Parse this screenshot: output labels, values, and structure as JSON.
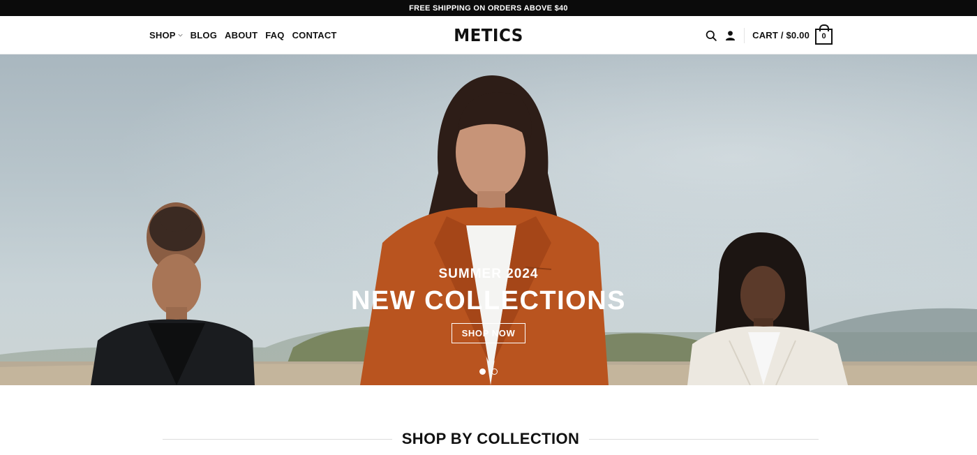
{
  "promo": {
    "text": "FREE SHIPPING ON ORDERS ABOVE $40"
  },
  "nav": {
    "items": [
      {
        "label": "SHOP",
        "has_dropdown": true
      },
      {
        "label": "BLOG"
      },
      {
        "label": "ABOUT"
      },
      {
        "label": "FAQ"
      },
      {
        "label": "CONTACT"
      }
    ]
  },
  "brand": {
    "logo": "METICS"
  },
  "header_actions": {
    "search_icon": "search-icon",
    "account_icon": "user-icon",
    "cart_label": "CART / $0.00",
    "cart_count": "0"
  },
  "hero": {
    "subtitle": "SUMMER 2024",
    "title": "NEW COLLECTIONS",
    "cta_label": "SHOP NOW",
    "slides_total": 2,
    "active_slide": 1
  },
  "sections": {
    "shop_by_collection": "SHOP BY COLLECTION"
  },
  "colors": {
    "topbar_bg": "#0b0b0b",
    "text": "#111111",
    "accent_jacket": "#b9541f"
  }
}
